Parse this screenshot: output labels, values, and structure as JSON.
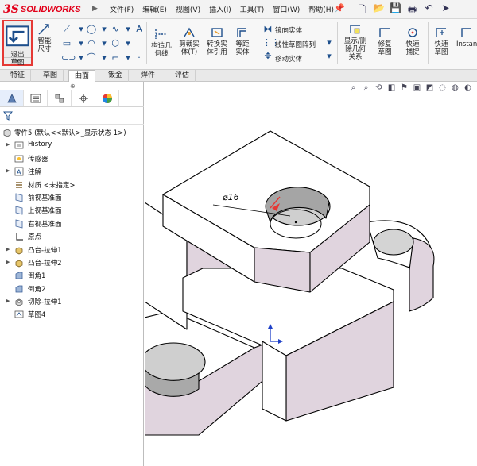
{
  "app": {
    "logo_ds": "3S",
    "logo_name": "SOLIDWORKS"
  },
  "menu": [
    "文件(F)",
    "编辑(E)",
    "视图(V)",
    "插入(I)",
    "工具(T)",
    "窗口(W)",
    "帮助(H)"
  ],
  "ribbon": {
    "exit_sketch": "退出草图",
    "smart_dim": "智能尺寸",
    "construction": "构造几何线",
    "trim": "剪裁实体(T)",
    "convert": "转换实体引用",
    "offset": "等距实体",
    "mirror": "镜向实体",
    "linear_pattern": "线性草图阵列",
    "move": "移动实体",
    "display_relations": "显示/删除几何关系",
    "repair": "修复草图",
    "quick_snap": "快速捕捉",
    "rapid_sketch": "快速草图",
    "instant": "Instan"
  },
  "tabs": [
    "特征",
    "草图",
    "曲面",
    "钣金",
    "焊件",
    "评估"
  ],
  "active_tab": 2,
  "tree": {
    "root": "零件5 (默认<<默认>_显示状态 1>)",
    "items": [
      "History",
      "传感器",
      "注解",
      "材质 <未指定>",
      "前视基准面",
      "上视基准面",
      "右视基准面",
      "原点",
      "凸台-拉伸1",
      "凸台-拉伸2",
      "倒角1",
      "倒角2",
      "切除-拉伸1",
      "草图4"
    ]
  },
  "drawing": {
    "dimension": "⌀16",
    "colors": {
      "face_top": "#ffffff",
      "face_side": "#e0d4de",
      "edge": "#000000",
      "dim_arrow": "#e53935",
      "axis": "#1e40c8"
    }
  }
}
